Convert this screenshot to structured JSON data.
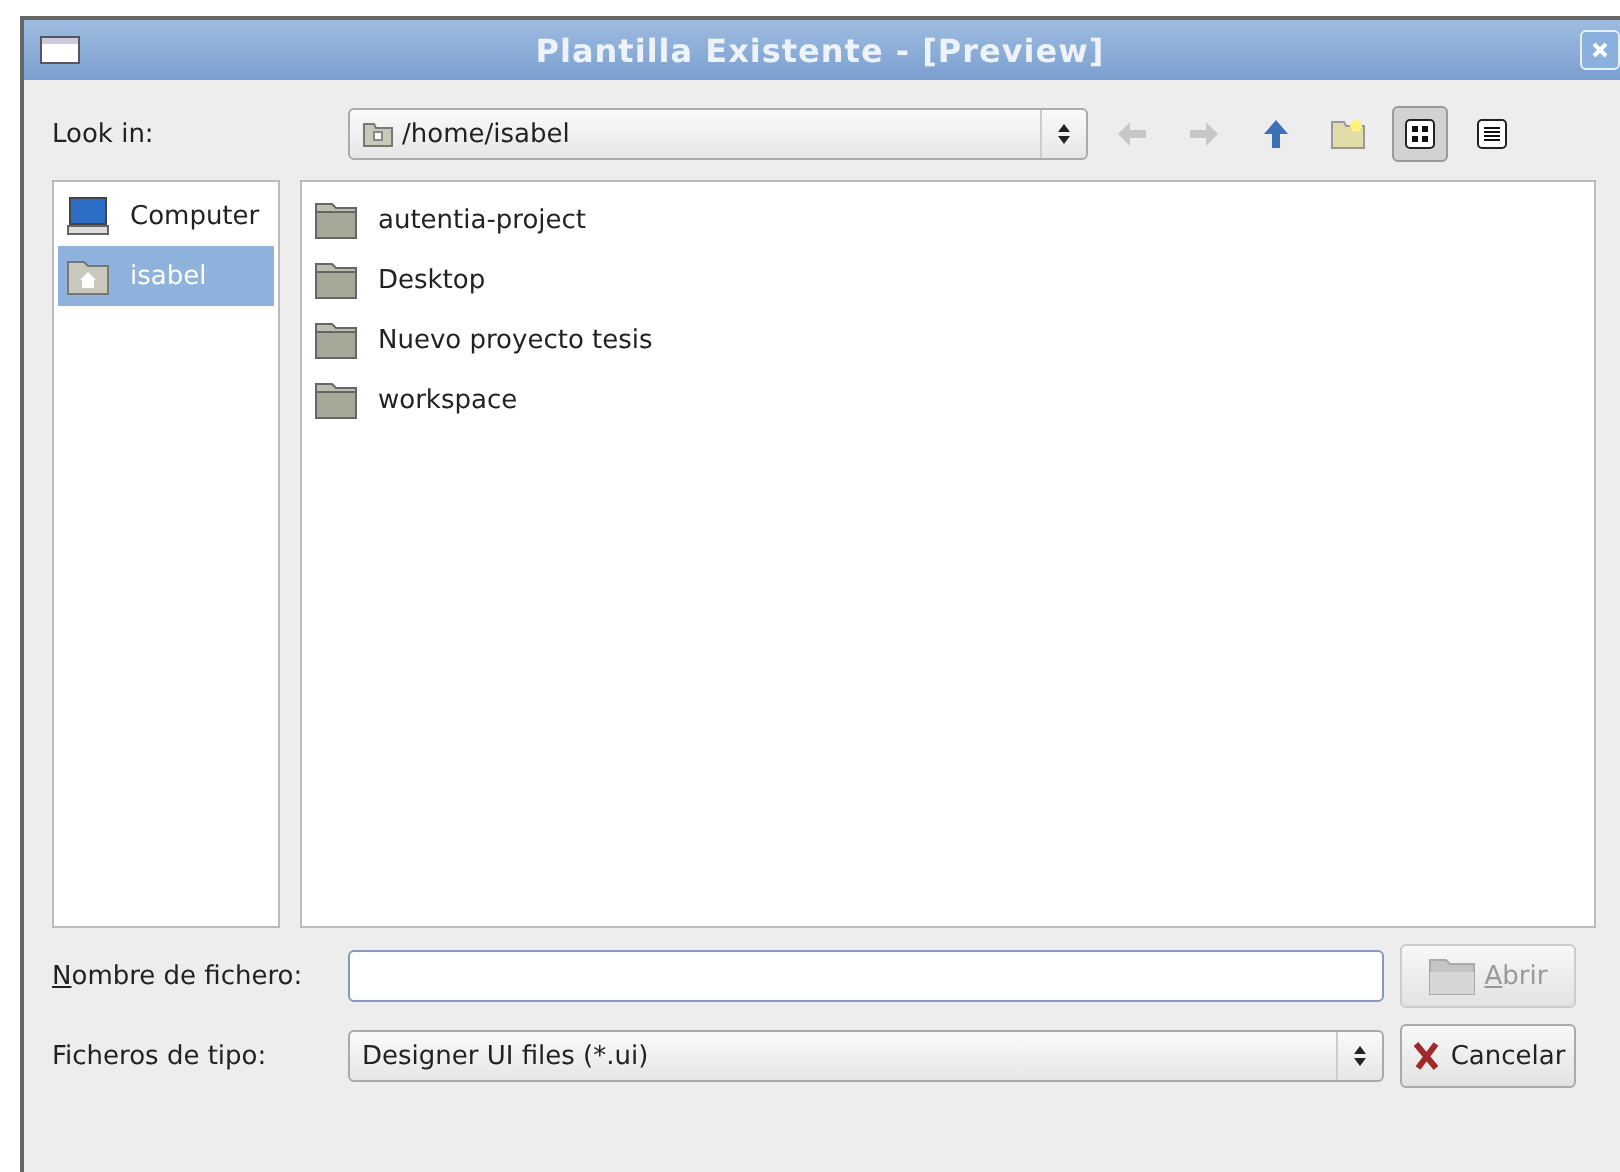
{
  "window": {
    "title": "Plantilla Existente - [Preview]"
  },
  "look_in": {
    "label": "Look in:",
    "path": "/home/isabel"
  },
  "toolbar": [
    {
      "kind": "back",
      "disabled": true,
      "selected": false
    },
    {
      "kind": "forward",
      "disabled": true,
      "selected": false
    },
    {
      "kind": "up",
      "disabled": false,
      "selected": false
    },
    {
      "kind": "new-folder",
      "disabled": false,
      "selected": false
    },
    {
      "kind": "icon-view",
      "disabled": false,
      "selected": true
    },
    {
      "kind": "detail-view",
      "disabled": false,
      "selected": false
    }
  ],
  "sidebar": {
    "items": [
      {
        "label": "Computer",
        "kind": "computer",
        "selected": false
      },
      {
        "label": "isabel",
        "kind": "home",
        "selected": true
      }
    ]
  },
  "files": [
    {
      "name": "autentia-project"
    },
    {
      "name": "Desktop"
    },
    {
      "name": "Nuevo proyecto tesis"
    },
    {
      "name": "workspace"
    }
  ],
  "filename": {
    "label": "Nombre de fichero:",
    "mnemonic": true
  },
  "filetype": {
    "label": "Ficheros de tipo:",
    "value": "Designer UI files (*.ui)"
  },
  "buttons": [
    {
      "label": "Abrir",
      "kind": "open",
      "disabled": true,
      "mnemonic": true
    },
    {
      "label": "Cancelar",
      "kind": "cancel",
      "disabled": false,
      "mnemonic": false
    }
  ]
}
